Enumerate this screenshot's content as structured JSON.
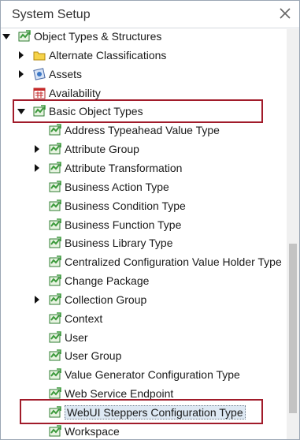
{
  "window": {
    "title": "System Setup",
    "close_icon": "close-icon"
  },
  "tree": {
    "root": {
      "label": "Object Types & Structures",
      "icon": "object-type-icon",
      "expanded": true
    },
    "level1": [
      {
        "label": "Alternate Classifications",
        "icon": "folder-icon",
        "expandable": true
      },
      {
        "label": "Assets",
        "icon": "asset-icon",
        "expandable": true
      },
      {
        "label": "Availability",
        "icon": "calendar-icon",
        "expandable": false
      },
      {
        "label": "Basic Object Types",
        "icon": "object-type-icon",
        "expandable": true,
        "expanded": true
      }
    ],
    "level2": [
      {
        "label": "Address Typeahead Value Type",
        "expandable": false
      },
      {
        "label": "Attribute Group",
        "expandable": true
      },
      {
        "label": "Attribute Transformation",
        "expandable": true
      },
      {
        "label": "Business Action Type",
        "expandable": false
      },
      {
        "label": "Business Condition Type",
        "expandable": false
      },
      {
        "label": "Business Function Type",
        "expandable": false
      },
      {
        "label": "Business Library Type",
        "expandable": false
      },
      {
        "label": "Centralized Configuration Value Holder Type",
        "expandable": false
      },
      {
        "label": "Change Package",
        "expandable": false
      },
      {
        "label": "Collection Group",
        "expandable": true
      },
      {
        "label": "Context",
        "expandable": false
      },
      {
        "label": "User",
        "expandable": false
      },
      {
        "label": "User Group",
        "expandable": false
      },
      {
        "label": "Value Generator Configuration Type",
        "expandable": false
      },
      {
        "label": "Web Service Endpoint",
        "expandable": false
      },
      {
        "label": "WebUI Steppers Configuration Type",
        "expandable": false,
        "selected": true
      },
      {
        "label": "Workspace",
        "expandable": false
      }
    ]
  },
  "colors": {
    "highlight_border": "#a11b2a",
    "selection_bg": "#dde8f3",
    "icon_green": "#3c9a3c"
  }
}
